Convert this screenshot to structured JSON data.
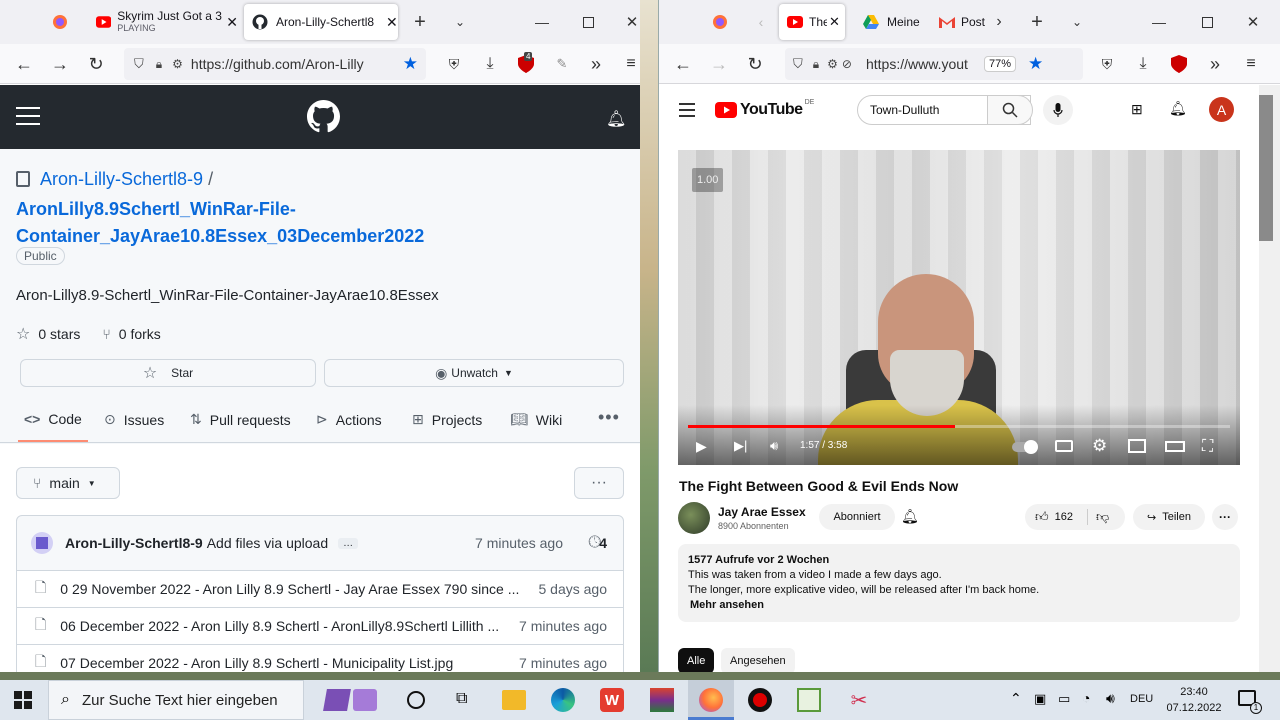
{
  "left": {
    "tabs": [
      {
        "title": "Skyrim Just Got a 3",
        "sub": "PLAYING"
      },
      {
        "title": "Aron-Lilly-Schertl8"
      }
    ],
    "url": "https://github.com/Aron-Lilly",
    "ext_badge": "4",
    "repo": {
      "owner": "Aron-Lilly-Schertl8-9",
      "sep": "/",
      "name_line1": "AronLilly8.9Schertl_WinRar-File-",
      "name_line2": "Container_JayArae10.8Essex_03December2022",
      "visibility": "Public",
      "description": "Aron-Lilly8.9-Schertl_WinRar-File-Container-JayArae10.8Essex",
      "stars": "0 stars",
      "forks": "0 forks",
      "star_btn": "Star",
      "watch_btn": "Unwatch"
    },
    "nav": [
      "Code",
      "Issues",
      "Pull requests",
      "Actions",
      "Projects",
      "Wiki"
    ],
    "branch": "main",
    "commit": {
      "author": "Aron-Lilly-Schertl8-9",
      "message": "Add files via upload",
      "ellipsis": "…",
      "time": "7 minutes ago",
      "count": "4"
    },
    "files": [
      {
        "name": "0 29 November 2022 - Aron Lilly 8.9 Schertl - Jay Arae Essex 790 since ...",
        "time": "5 days ago"
      },
      {
        "name": "06 December 2022 - Aron Lilly 8.9 Schertl - AronLilly8.9Schertl Lillith ...",
        "time": "7 minutes ago"
      },
      {
        "name": "07 December 2022 - Aron Lilly 8.9 Schertl - Municipality List.jpg",
        "time": "7 minutes ago"
      }
    ]
  },
  "right": {
    "tabs": [
      {
        "title": "The"
      },
      {
        "title": "Meine"
      },
      {
        "title": "Post"
      }
    ],
    "url": "https://www.yout",
    "zoom": "77%",
    "youtube": {
      "logo_text": "YouTube",
      "region": "DE",
      "search_value": "Town-Dulluth",
      "avatar_letter": "A",
      "speed": "1.00",
      "time": "1:57 / 3:58",
      "progress": 0.493,
      "title": "The Fight Between Good & Evil Ends Now",
      "channel": "Jay Arae Essex",
      "subscribers": "8900 Abonnenten",
      "subscribed_btn": "Abonniert",
      "likes": "162",
      "share": "Teilen",
      "desc_stats": "1577 Aufrufe  vor 2 Wochen",
      "desc_line1": "This was taken from a video I made a few days ago.",
      "desc_line2": "The longer, more explicative video, will be released after I'm back home.",
      "more": "Mehr ansehen",
      "chips": [
        "Alle",
        "Angesehen"
      ]
    }
  },
  "taskbar": {
    "search_placeholder": "Zur Suche Text hier eingeben",
    "lang": "DEU",
    "time": "23:40",
    "date": "07.12.2022",
    "notif": "1"
  },
  "colors": {
    "github_header": "#24292f",
    "github_link": "#0969da",
    "youtube_red": "#ff0000",
    "taskbar": "#dfe6ee"
  }
}
